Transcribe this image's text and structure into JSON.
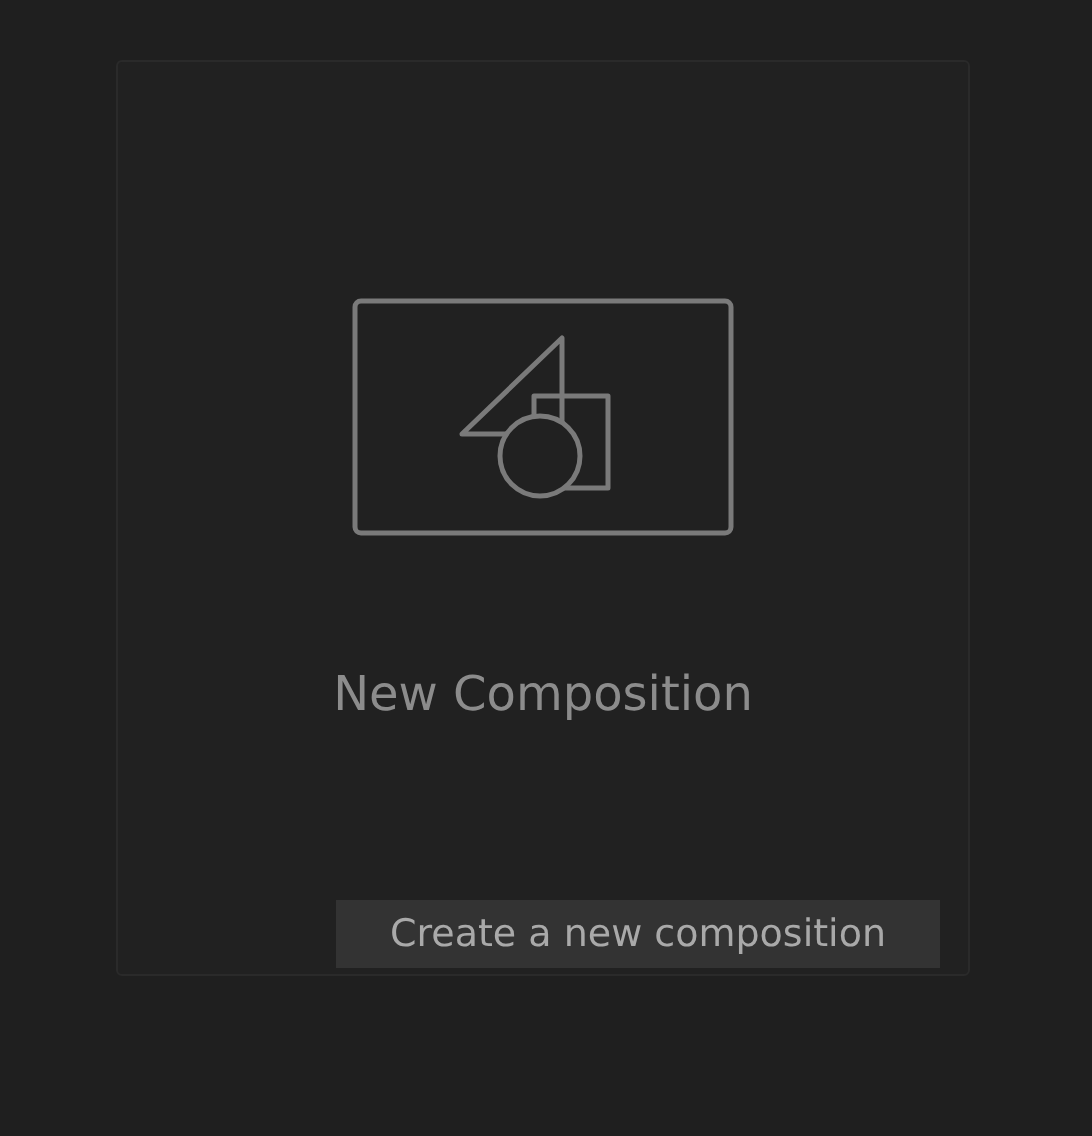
{
  "card": {
    "title": "New Composition"
  },
  "tooltip": {
    "text": "Create a new composition"
  }
}
